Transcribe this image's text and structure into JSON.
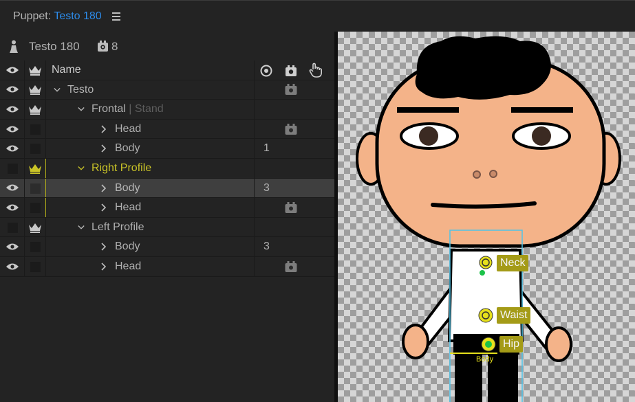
{
  "title_bar": {
    "prefix": "Puppet:",
    "puppet_name": "Testo 180"
  },
  "puppet_info": {
    "name": "Testo 180",
    "count": "8"
  },
  "table": {
    "header": {
      "name": "Name"
    },
    "rows": [
      {
        "name": "Testo",
        "sub": "",
        "count": "",
        "has_count_icon": true,
        "indent": 0
      },
      {
        "name": "Frontal",
        "sub": " | Stand",
        "count": "",
        "has_count_icon": false,
        "indent": 1
      },
      {
        "name": "Head",
        "sub": "",
        "count": "",
        "has_count_icon": true,
        "indent": 2
      },
      {
        "name": "Body",
        "sub": "",
        "count": "1",
        "has_count_icon": false,
        "indent": 2
      },
      {
        "name": "Right Profile",
        "sub": "",
        "count": "",
        "has_count_icon": false,
        "indent": 1
      },
      {
        "name": "Body",
        "sub": "",
        "count": "3",
        "has_count_icon": false,
        "indent": 2
      },
      {
        "name": "Head",
        "sub": "",
        "count": "",
        "has_count_icon": true,
        "indent": 2
      },
      {
        "name": "Left Profile",
        "sub": "",
        "count": "",
        "has_count_icon": false,
        "indent": 1
      },
      {
        "name": "Body",
        "sub": "",
        "count": "3",
        "has_count_icon": false,
        "indent": 2
      },
      {
        "name": "Head",
        "sub": "",
        "count": "",
        "has_count_icon": true,
        "indent": 2
      }
    ]
  },
  "canvas": {
    "handles": {
      "neck": "Neck",
      "waist": "Waist",
      "hip": "Hip"
    },
    "body_label": "Body"
  },
  "colors": {
    "accent_blue": "#2d8ceb",
    "accent_yellow": "#c9c327",
    "skin": "#f4b389",
    "tag_bg": "#a49b17"
  },
  "icons": [
    "puppet-icon",
    "puppet-count-icon",
    "eye-icon",
    "crown-icon",
    "origin-icon",
    "camera-icon",
    "hand-icon",
    "chevron-down-icon",
    "chevron-right-icon",
    "menu-icon"
  ]
}
